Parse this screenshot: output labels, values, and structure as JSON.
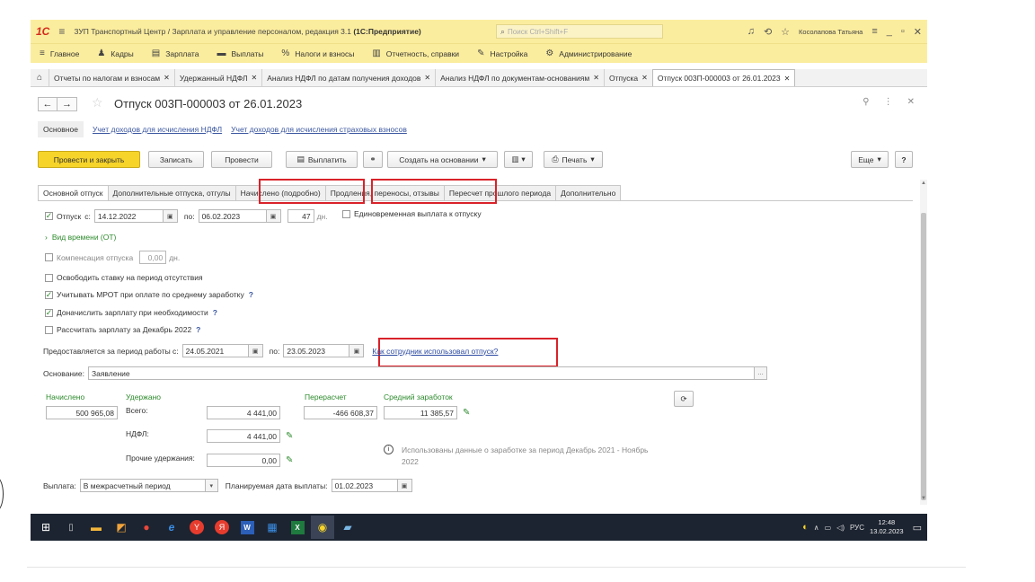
{
  "titlebar": {
    "logo": "1С",
    "title_prefix": "ЗУП Транспортный Центр / Зарплата и управление персоналом, редакция 3.1 ",
    "title_suffix": "(1С:Предприятие)",
    "search_placeholder": "Поиск Ctrl+Shift+F",
    "user": "Косолапова Татьяна"
  },
  "sections": [
    {
      "icon": "≡",
      "label": "Главное"
    },
    {
      "icon": "♟",
      "label": "Кадры"
    },
    {
      "icon": "▤",
      "label": "Зарплата"
    },
    {
      "icon": "▬",
      "label": "Выплаты"
    },
    {
      "icon": "%",
      "label": "Налоги и взносы"
    },
    {
      "icon": "▥",
      "label": "Отчетность, справки"
    },
    {
      "icon": "✎",
      "label": "Настройка"
    },
    {
      "icon": "⚙",
      "label": "Администрирование"
    }
  ],
  "open_tabs": [
    "Отчеты по налогам и взносам",
    "Удержанный НДФЛ",
    "Анализ НДФЛ по датам получения доходов",
    "Анализ НДФЛ по документам-основаниям",
    "Отпуска",
    "Отпуск 003П-000003 от 26.01.2023"
  ],
  "form": {
    "title": "Отпуск 003П-000003 от 26.01.2023",
    "subnav": {
      "current": "Основное",
      "link1": "Учет доходов для исчисления НДФЛ",
      "link2": "Учет доходов для исчисления страховых взносов"
    },
    "toolbar": {
      "post_close": "Провести и закрыть",
      "save": "Записать",
      "post": "Провести",
      "pay": "Выплатить",
      "create_based": "Создать на основании",
      "print": "Печать",
      "more": "Еще",
      "help": "?"
    },
    "inner_tabs": [
      "Основной отпуск",
      "Дополнительные отпуска, отгулы",
      "Начислено (подробно)",
      "Продления, переносы, отзывы",
      "Пересчет прошлого периода",
      "Дополнительно"
    ],
    "vacation": {
      "label": "Отпуск",
      "from_label": "с:",
      "from": "14.12.2022",
      "to_label": "по:",
      "to": "06.02.2023",
      "days": "47",
      "days_unit": "дн.",
      "one_time_payment": "Единовременная выплата к отпуску"
    },
    "time_type": "Вид времени (ОТ)",
    "compensation": {
      "label": "Компенсация отпуска",
      "value": "0,00",
      "unit": "дн."
    },
    "free_rate": "Освободить ставку на период отсутствия",
    "mrot": "Учитывать МРОТ при оплате по среднему заработку",
    "extra_pay": "Доначислить зарплату при необходимости",
    "calc_salary": "Рассчитать зарплату за Декабрь 2022",
    "work_period": {
      "label": "Предоставляется за период работы с:",
      "from": "24.05.2021",
      "to_label": "по:",
      "to": "23.05.2023",
      "link": "Как сотрудник использовал отпуск?"
    },
    "reason": {
      "label": "Основание:",
      "value": "Заявление"
    },
    "totals": {
      "accrued_label": "Начислено",
      "accrued": "500 965,08",
      "withheld_label": "Удержано",
      "total_label": "Всего:",
      "total": "4 441,00",
      "ndfl_label": "НДФЛ:",
      "ndfl": "4 441,00",
      "other_label": "Прочие удержания:",
      "other": "0,00",
      "recalc_label": "Перерасчет",
      "recalc": "-466 608,37",
      "avg_label": "Средний заработок",
      "avg": "11 385,57",
      "info": "Использованы данные о заработке за период Декабрь 2021 - Ноябрь 2022"
    },
    "payout": {
      "label": "Выплата:",
      "value": "В межрасчетный период",
      "plan_label": "Планируемая дата выплаты:",
      "plan_date": "01.02.2023"
    }
  },
  "taskbar": {
    "lang": "РУС",
    "time": "12:48",
    "date": "13.02.2023"
  }
}
